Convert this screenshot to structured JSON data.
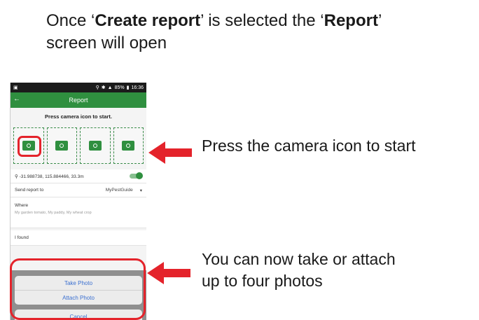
{
  "title": {
    "line1_pre": "Once ‘",
    "line1_bold1": "Create report",
    "line1_mid": "’ is selected the ‘",
    "line1_bold2": "Report",
    "line1_post": "’",
    "line2": "screen will open"
  },
  "phone": {
    "status_time": "16:36",
    "status_battery": "85%",
    "appbar_title": "Report",
    "prompt": "Press camera icon to start.",
    "camera_slots": [
      {
        "name": "camera-slot-1"
      },
      {
        "name": "camera-slot-2"
      },
      {
        "name": "camera-slot-3"
      },
      {
        "name": "camera-slot-4"
      }
    ],
    "gps": "-31.988738, 115.884466, 33.3m",
    "send_label": "Send report to",
    "send_value": "MyPestGuide",
    "where_label": "Where",
    "where_placeholder": "My garden tomato, My paddy, My wheat crop",
    "found_label": "I found",
    "sheet": {
      "take_photo": "Take Photo",
      "attach_photo": "Attach Photo",
      "cancel": "Cancel"
    }
  },
  "callouts": {
    "camera": "Press the camera icon to start",
    "photos_line1": "You can now take or attach",
    "photos_line2": "up to four photos"
  },
  "colors": {
    "accent_green": "#2f8f3f",
    "highlight_red": "#e4232b",
    "link_blue": "#3a6fd0"
  }
}
